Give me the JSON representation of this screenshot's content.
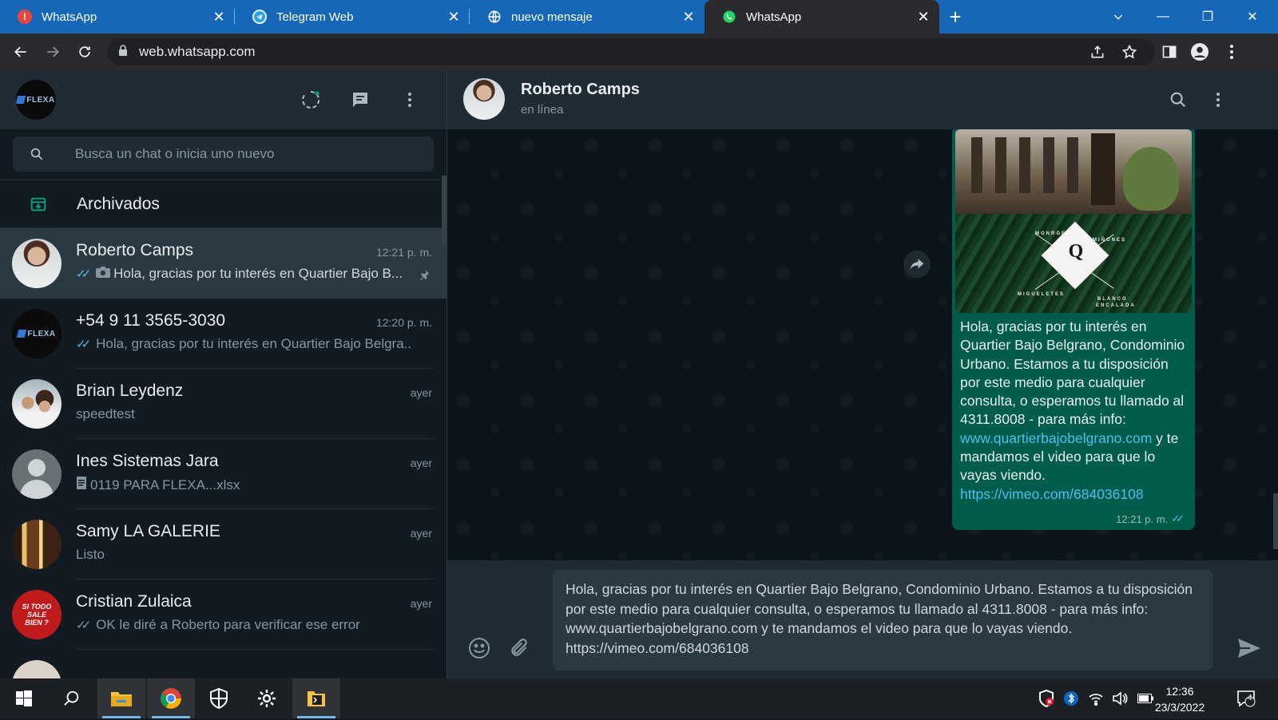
{
  "browser": {
    "tabs": [
      {
        "title": "WhatsApp",
        "favicon": "alert-favicon",
        "active": false
      },
      {
        "title": "Telegram Web",
        "favicon": "telegram-favicon",
        "active": false
      },
      {
        "title": "nuevo mensaje",
        "favicon": "globe-favicon",
        "active": false
      },
      {
        "title": "WhatsApp",
        "favicon": "whatsapp-favicon",
        "active": true
      }
    ],
    "url": "web.whatsapp.com"
  },
  "sidebar": {
    "my_avatar_text": "FLEXA",
    "search_placeholder": "Busca un chat o inicia uno nuevo",
    "archived_label": "Archivados",
    "chats": [
      {
        "name": "Roberto Camps",
        "time": "12:21 p. m.",
        "preview": "Hola, gracias por tu interés en Quartier Bajo B...",
        "ticks": "read",
        "has_photo_icon": true,
        "pinned": true,
        "selected": true
      },
      {
        "name": "+54 9 11 3565-3030",
        "time": "12:20 p. m.",
        "preview": "Hola, gracias por tu interés en Quartier Bajo Belgra...",
        "ticks": "read"
      },
      {
        "name": "Brian Leydenz",
        "time": "ayer",
        "preview": "speedtest"
      },
      {
        "name": "Ines Sistemas Jara",
        "time": "ayer",
        "preview": "0119 PARA FLEXA...xlsx",
        "has_doc_icon": true
      },
      {
        "name": "Samy LA GALERIE",
        "time": "ayer",
        "preview": "Listo"
      },
      {
        "name": "Cristian Zulaica",
        "time": "ayer",
        "preview": "OK le diré a Roberto para verificar ese error",
        "ticks": "delivered"
      }
    ],
    "cristian_avatar_text": "SI TODO SALE BIEN ?"
  },
  "conversation": {
    "contact_name": "Roberto Camps",
    "status": "en línea",
    "image_words": {
      "top_left": "MONROE",
      "top_right": "MIÑONES",
      "bottom_left": "MIGUELETES",
      "bottom_right_1": "BLANCO",
      "bottom_right_2": "ENCALADA",
      "logo": "Q"
    },
    "message_text_1": "Hola, gracias por tu interés en Quartier Bajo Belgrano, Condominio Urbano. Estamos a tu disposición por este medio para cualquier consulta, o esperamos tu llamado al 4311.8008  - para más info: ",
    "message_link_1": "www.quartierbajobelgrano.com",
    "message_text_2": " y te mandamos el video para que lo vayas viendo.",
    "message_link_2": "https://vimeo.com/684036108",
    "message_time": "12:21 p. m.",
    "composer_text": "Hola, gracias por tu interés en Quartier Bajo Belgrano, Condominio Urbano. Estamos a tu disposición por este medio para cualquier consulta, o esperamos tu llamado al 4311.8008  - para más info: www.quartierbajobelgrano.com y te mandamos el video para que lo vayas viendo. https://vimeo.com/684036108"
  },
  "taskbar": {
    "time": "12:36",
    "date": "23/3/2022",
    "notification_count": "4"
  },
  "colors": {
    "tab_strip": "#1667b8",
    "wa_panel": "#202c33",
    "wa_background": "#111b21",
    "outgoing_bubble": "#005c4b",
    "accent": "#00a884",
    "read_ticks": "#53bdeb"
  }
}
